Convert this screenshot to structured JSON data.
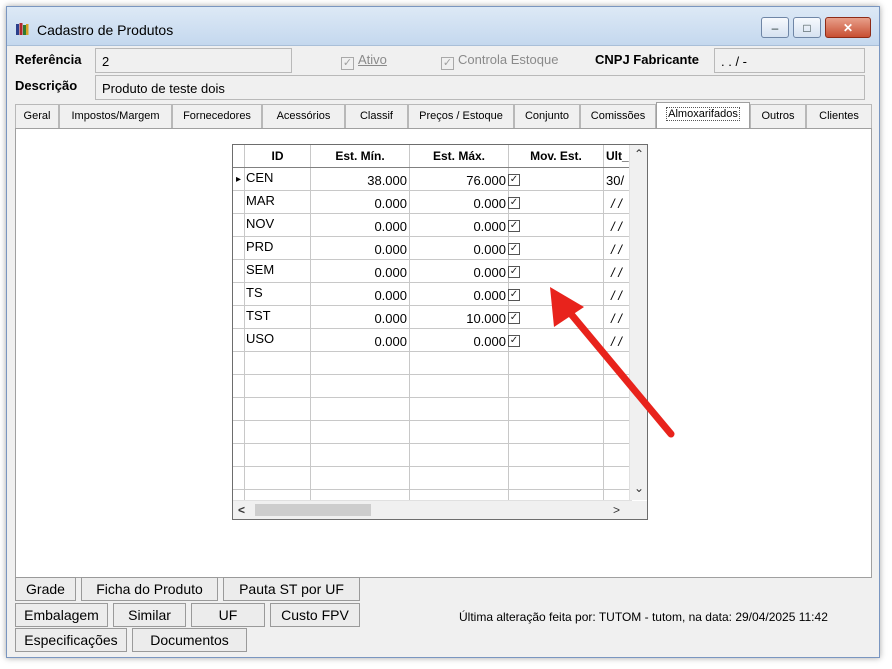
{
  "window": {
    "title": "Cadastro de Produtos",
    "minimize_glyph": "–",
    "maximize_glyph": "□",
    "close_glyph": "✕",
    "icon": "app-books-icon"
  },
  "form": {
    "referencia_label": "Referência",
    "referencia_value": "2",
    "ativo_label": "Ativo",
    "ativo_checked": true,
    "controla_estoque_label": "Controla Estoque",
    "controla_estoque_checked": true,
    "cnpj_label": "CNPJ Fabricante",
    "cnpj_value": ". . /  -",
    "descricao_label": "Descrição",
    "descricao_value": "Produto de teste dois",
    "check_glyph": "✓"
  },
  "tabs": [
    {
      "label": "Geral"
    },
    {
      "label": "Impostos/Margem"
    },
    {
      "label": "Fornecedores"
    },
    {
      "label": "Acessórios"
    },
    {
      "label": "Classif"
    },
    {
      "label": "Preços / Estoque"
    },
    {
      "label": "Conjunto"
    },
    {
      "label": "Comissões"
    },
    {
      "label": "Almoxarifados",
      "active": true
    },
    {
      "label": "Outros"
    },
    {
      "label": "Clientes"
    }
  ],
  "grid": {
    "columns": [
      "ID",
      "Est. Mín.",
      "Est. Máx.",
      "Mov. Est.",
      "Ult_"
    ],
    "row_marker": "▸",
    "rows": [
      {
        "id": "CEN",
        "min": "38.000",
        "max": "76.000",
        "mov": true,
        "ult": "30/"
      },
      {
        "id": "MAR",
        "min": "0.000",
        "max": "0.000",
        "mov": true,
        "ult": "/ /"
      },
      {
        "id": "NOV",
        "min": "0.000",
        "max": "0.000",
        "mov": true,
        "ult": "/ /"
      },
      {
        "id": "PRD",
        "min": "0.000",
        "max": "0.000",
        "mov": true,
        "ult": "/ /"
      },
      {
        "id": "SEM",
        "min": "0.000",
        "max": "0.000",
        "mov": true,
        "ult": "/ /"
      },
      {
        "id": "TS",
        "min": "0.000",
        "max": "0.000",
        "mov": true,
        "ult": "/ /"
      },
      {
        "id": "TST",
        "min": "0.000",
        "max": "10.000",
        "mov": true,
        "ult": "/ /"
      },
      {
        "id": "USO",
        "min": "0.000",
        "max": "0.000",
        "mov": true,
        "ult": "/ /"
      }
    ],
    "scroll_up": "⌃",
    "scroll_down": "⌄",
    "scroll_left": "<",
    "scroll_right": ">"
  },
  "annotation": {
    "color": "#e8231c"
  },
  "buttons": {
    "grade": "Grade",
    "ficha": "Ficha do Produto",
    "pauta": "Pauta ST por UF",
    "embalagem": "Embalagem",
    "similar": "Similar",
    "uf": "UF",
    "custo": "Custo FPV",
    "especificacoes": "Especificações",
    "documentos": "Documentos"
  },
  "status": {
    "text": "Última alteração feita por: TUTOM - tutom, na data: 29/04/2025 11:42"
  }
}
